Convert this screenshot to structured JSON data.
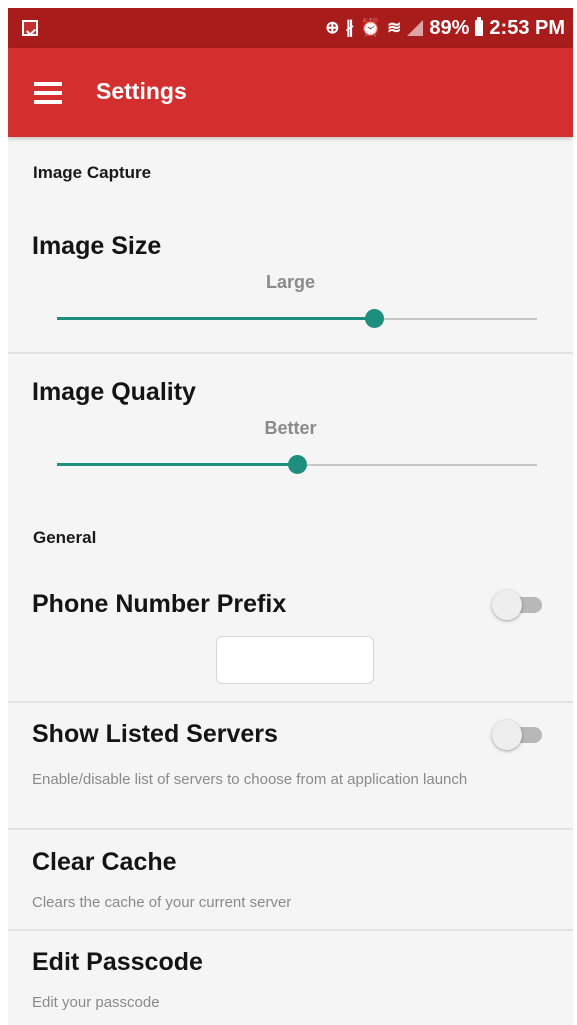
{
  "status_bar": {
    "battery": "89%",
    "time": "2:53 PM",
    "icons": [
      "image-notification-icon",
      "sync-icon",
      "bluetooth-icon",
      "alarm-icon",
      "wifi-icon",
      "signal-icon",
      "battery-icon"
    ]
  },
  "toolbar": {
    "title": "Settings",
    "menu_icon": "hamburger-menu-icon"
  },
  "sections": {
    "image_capture": {
      "header": "Image Capture",
      "image_size": {
        "title": "Image Size",
        "value_label": "Large",
        "position": 0.66
      },
      "image_quality": {
        "title": "Image Quality",
        "value_label": "Better",
        "position": 0.5
      }
    },
    "general": {
      "header": "General",
      "phone_prefix": {
        "title": "Phone Number Prefix",
        "enabled": false,
        "input_value": ""
      },
      "show_listed_servers": {
        "title": "Show Listed Servers",
        "summary": "Enable/disable list of servers to choose from at application launch",
        "enabled": false
      },
      "clear_cache": {
        "title": "Clear Cache",
        "summary": "Clears the cache of your current server"
      },
      "edit_passcode": {
        "title": "Edit Passcode",
        "summary": "Edit your passcode"
      }
    }
  },
  "colors": {
    "status_bar": "#a81c1c",
    "toolbar": "#d32f2f",
    "accent": "#1e8f7e",
    "background": "#f5f5f5"
  }
}
